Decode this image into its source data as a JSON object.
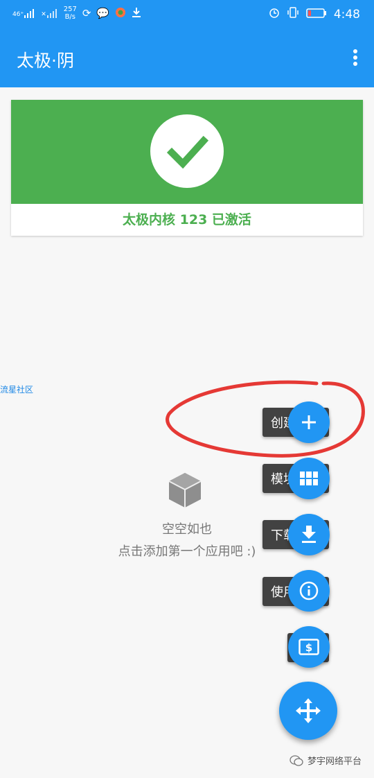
{
  "status_bar": {
    "signal1": "46⁺",
    "signal2": "✕",
    "speed_value": "257",
    "speed_unit": "B/s",
    "time": "4:48",
    "icons": [
      "sync-icon",
      "chat-icon",
      "app-icon",
      "download-icon",
      "alarm-icon",
      "vibrate-icon",
      "battery-icon"
    ]
  },
  "appbar": {
    "title": "太极·阴"
  },
  "card": {
    "status": "太极内核 123 已激活",
    "colors": {
      "green": "#4caf50"
    }
  },
  "side_link": "流星社区",
  "empty": {
    "line1": "空空如也",
    "line2": "点击添加第一个应用吧 :)"
  },
  "fab_menu": {
    "create_app": "创建应用",
    "module_manage": "模块管理",
    "download_module": "下载模块",
    "instructions": "使用说明",
    "donate": "捐赠"
  },
  "watermark": "梦宇网络平台",
  "colors": {
    "primary": "#2196f3",
    "annotation_red": "#e53935"
  }
}
